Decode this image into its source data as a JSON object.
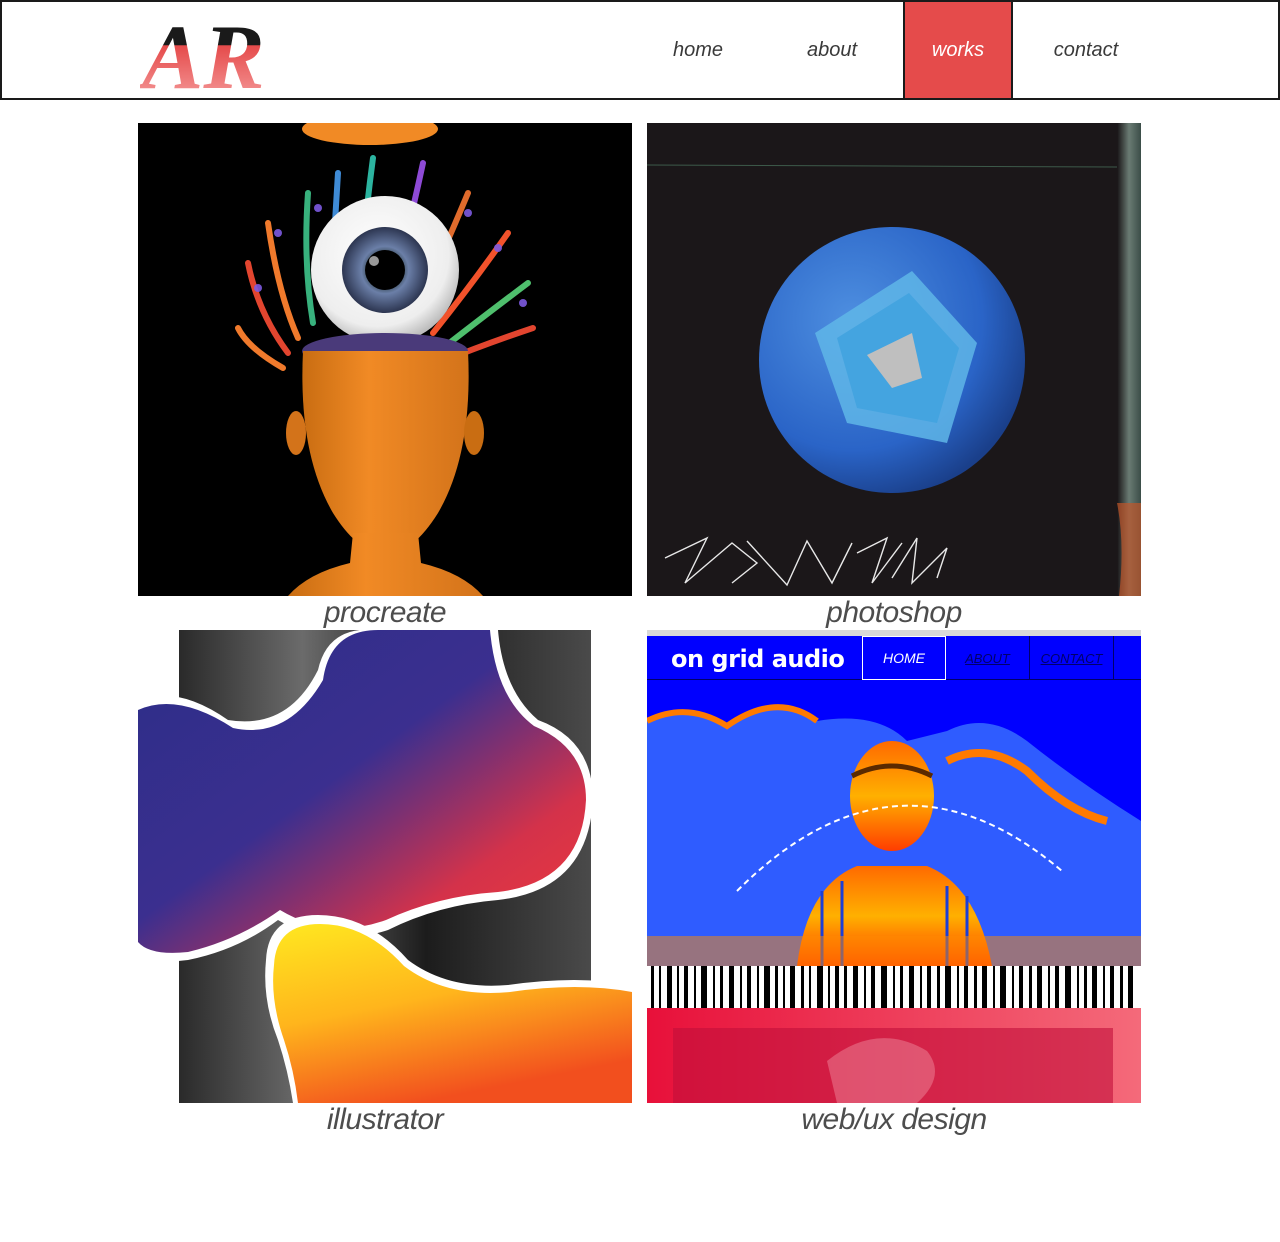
{
  "brand": {
    "logo_text": "AR",
    "accent": "#e54b4b"
  },
  "nav": {
    "items": [
      {
        "label": "home"
      },
      {
        "label": "about"
      },
      {
        "label": "works",
        "active": true
      },
      {
        "label": "contact"
      }
    ]
  },
  "works": {
    "tiles": [
      {
        "caption": "procreate"
      },
      {
        "caption": "photoshop"
      },
      {
        "caption": "illustrator"
      },
      {
        "caption": "web/ux design"
      }
    ],
    "webux_preview": {
      "site_name": "on grid audio",
      "nav_home": "HOME",
      "nav_about": "ABOUT",
      "nav_contact": "CONTACT"
    }
  }
}
